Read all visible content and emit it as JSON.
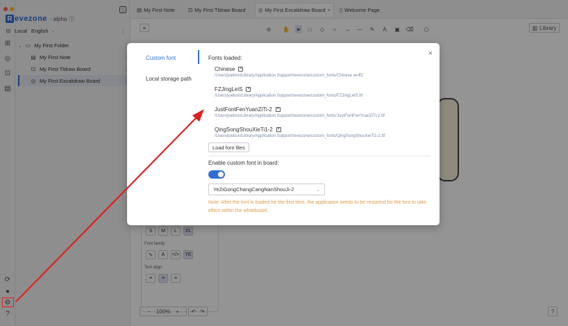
{
  "sidebar": {
    "app_name": "evezone",
    "logo_letter": "R",
    "version": "- alpha",
    "storage_label": "Local",
    "language": "English",
    "items": [
      {
        "label": "My First Folder",
        "icon": "folder-icon"
      },
      {
        "label": "My First Note",
        "icon": "note-icon"
      },
      {
        "label": "My First Tldraw Board",
        "icon": "board-icon"
      },
      {
        "label": "My First Excalidraw Board",
        "icon": "palette-icon"
      }
    ]
  },
  "tabs": [
    {
      "label": "My First Note",
      "icon": "note-icon"
    },
    {
      "label": "My First Tldraw Board",
      "icon": "board-icon"
    },
    {
      "label": "My First Excalidraw Board",
      "icon": "palette-icon",
      "active": true
    },
    {
      "label": "Welcome Page",
      "icon": "page-icon"
    }
  ],
  "canvas": {
    "library_label": "Library",
    "zoom": "100%",
    "sizes": [
      "S",
      "M",
      "L",
      "XL"
    ],
    "font_family_label": "Font family",
    "text_align_label": "Text align"
  },
  "modal": {
    "nav": [
      {
        "label": "Custom font",
        "active": true
      },
      {
        "label": "Local storage path"
      }
    ],
    "fonts_loaded_label": "Fonts loaded:",
    "fonts": [
      {
        "name": "Chinese",
        "path": "/Users/joebon/Library/Application Support/revezone/custom_fonts/Chinese.woff2"
      },
      {
        "name": "FZJingLeiS",
        "path": "/Users/joebon/Library/Application Support/revezone/custom_fonts/FZJingLeiS.ttf"
      },
      {
        "name": "JustFontFenYuanZiTi-2",
        "path": "/Users/joebon/Library/Application Support/revezone/custom_fonts/JustFontFenYuanZiTi-2.ttf"
      },
      {
        "name": "QingSongShouXieTi1-2",
        "path": "/Users/joebon/Library/Application Support/revezone/custom_fonts/QingSongShouXieTi1-2.ttf"
      }
    ],
    "load_button": "Load font files",
    "enable_label": "Enable custom font in board:",
    "toggle_on": true,
    "selected_font": "YeZiGongChangCangNanShouJi-2",
    "note": "Note: After the font is loaded for the first time, the application needs to be restarted for the font to take effect within the whiteboard."
  },
  "colors": {
    "accent": "#2f6fd6",
    "note": "#e39a48",
    "annotation": "#e02020"
  }
}
